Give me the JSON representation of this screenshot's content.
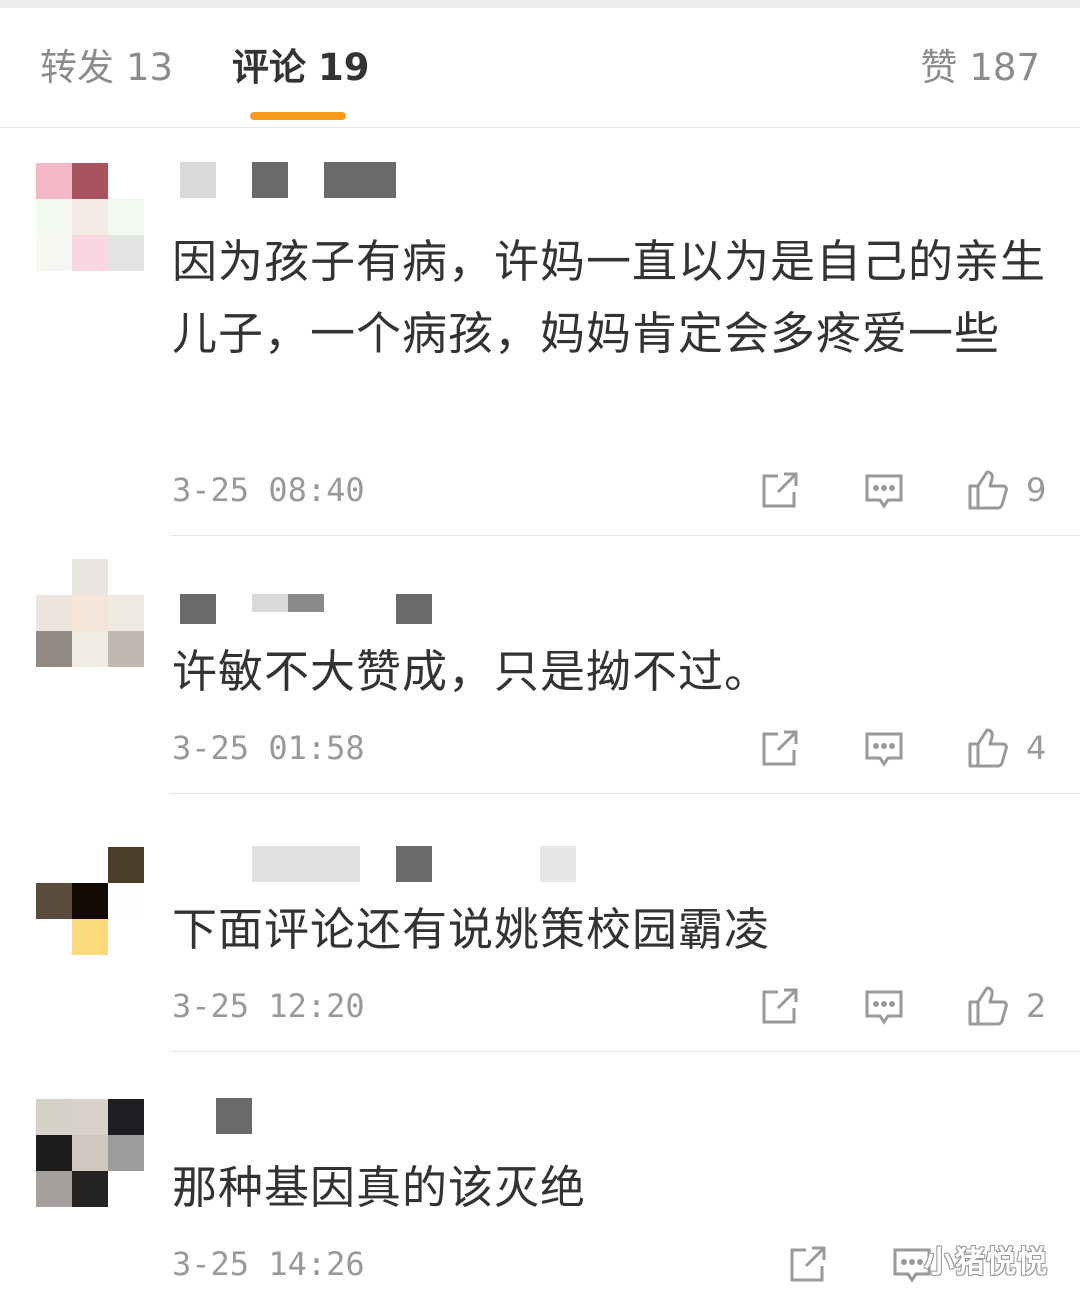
{
  "tabs": {
    "repost": {
      "label": "转发",
      "count": "13"
    },
    "comments": {
      "label": "评论",
      "count": "19"
    },
    "likes": {
      "label": "赞",
      "count": "187"
    }
  },
  "colors": {
    "accent": "#f79b1c",
    "text": "#333333",
    "muted": "#999999",
    "divider": "#e6e6e6"
  },
  "comments": [
    {
      "text": "因为孩子有病，许妈一直以为是自己的亲生儿子，一个病孩，妈妈肯定会多疼爱一些",
      "time": "3-25 08:40",
      "likes": "9"
    },
    {
      "text": "许敏不大赞成，只是拗不过。",
      "time": "3-25 01:58",
      "likes": "4"
    },
    {
      "text": "下面评论还有说姚策校园霸凌",
      "time": "3-25 12:20",
      "likes": "2"
    },
    {
      "text": "那种基因真的该灭绝",
      "time": "3-25 14:26",
      "likes": ""
    }
  ],
  "actions": {
    "share_icon": "share-icon",
    "reply_icon": "comment-icon",
    "like_icon": "thumbs-up-icon"
  },
  "watermark": "小猪悦悦"
}
